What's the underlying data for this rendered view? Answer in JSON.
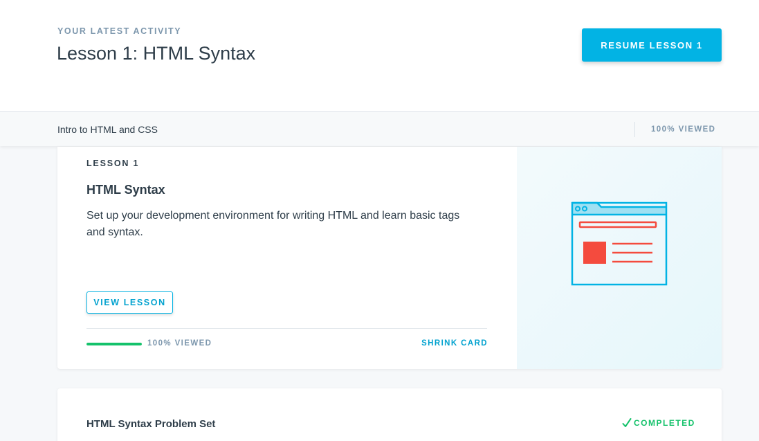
{
  "header": {
    "eyebrow": "YOUR LATEST ACTIVITY",
    "title": "Lesson 1: HTML Syntax",
    "resume_label": "RESUME LESSON 1"
  },
  "course_bar": {
    "course_name": "Intro to HTML and CSS",
    "progress_label": "100% VIEWED"
  },
  "lesson_card": {
    "eyebrow": "LESSON 1",
    "title": "HTML Syntax",
    "description": "Set up your development environment for writing HTML and learn basic tags and syntax.",
    "view_label": "VIEW LESSON",
    "progress_fraction": 1.0,
    "progress_label": "100% VIEWED",
    "shrink_label": "SHRINK CARD",
    "illustration_icon": "browser-window-icon"
  },
  "problem_card": {
    "title": "HTML Syntax Problem Set",
    "status_icon": "check-icon",
    "status_label": "COMPLETED"
  },
  "colors": {
    "accent": "#02b3e4",
    "success": "#15c26b",
    "illustration_red": "#f44b3e"
  }
}
